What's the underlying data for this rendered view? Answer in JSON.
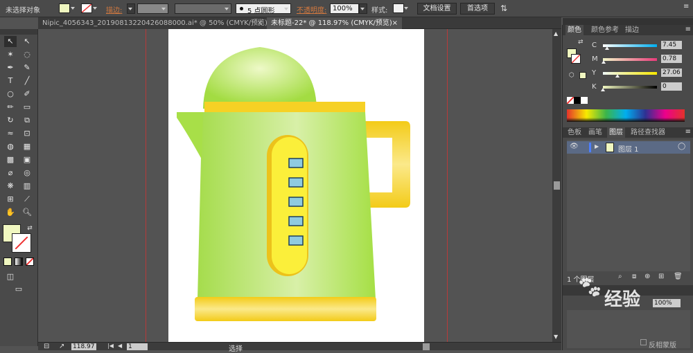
{
  "control_bar": {
    "selection_status": "未选择对象",
    "stroke_label": "描边:",
    "brush_value": "5 点圆形",
    "opacity_label": "不透明度:",
    "opacity_value": "100%",
    "style_label": "样式:",
    "doc_setup_button": "文档设置",
    "preferences_button": "首选项"
  },
  "doc_tabs": [
    {
      "label": "Nipic_4056343_20190813220426088000.ai* @ 50% (CMYK/预览)",
      "active": false
    },
    {
      "label": "未标题-22* @ 118.97% (CMYK/预览)",
      "active": true
    }
  ],
  "color_panel": {
    "tabs": [
      "颜色",
      "颜色参考",
      "描边"
    ],
    "sliders": [
      {
        "label": "C",
        "value": "7.45",
        "percent": 7.45
      },
      {
        "label": "M",
        "value": "0.78",
        "percent": 0.78
      },
      {
        "label": "Y",
        "value": "27.06",
        "percent": 27.06
      },
      {
        "label": "K",
        "value": "0",
        "percent": 0
      }
    ],
    "fill_color": "#f0f7c0"
  },
  "layers_panel": {
    "tabs": [
      "色板",
      "画笔",
      "图层",
      "路径查找器"
    ],
    "layer_name": "图层 1",
    "layer_count": "1 个图层"
  },
  "lower_panel": {
    "opacity_value": "100%",
    "checkbox_label": "反相蒙版"
  },
  "status_bar": {
    "zoom": "118.97",
    "page": "1",
    "mode": "选择"
  },
  "colors": {
    "accent": "#cc5533",
    "kettle_green": "#a9e04a",
    "kettle_yellow": "#f6d125",
    "window_blue": "#8fcbe0"
  },
  "watermark": "经验"
}
